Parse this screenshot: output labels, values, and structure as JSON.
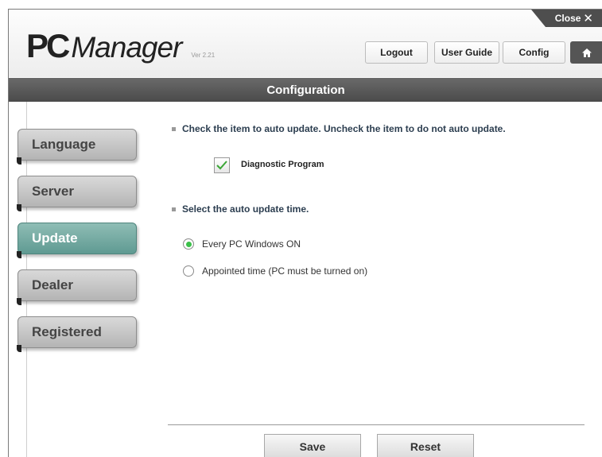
{
  "window": {
    "close_label": "Close"
  },
  "header": {
    "logo_pc": "PC",
    "logo_manager": "Manager",
    "version": "Ver 2.21",
    "buttons": {
      "logout": "Logout",
      "user_guide": "User Guide",
      "config": "Config"
    },
    "home_icon": "home-icon"
  },
  "title": "Configuration",
  "sidebar": {
    "items": [
      {
        "label": "Language",
        "active": false
      },
      {
        "label": "Server",
        "active": false
      },
      {
        "label": "Update",
        "active": true
      },
      {
        "label": "Dealer",
        "active": false
      },
      {
        "label": "Registered",
        "active": false
      }
    ]
  },
  "main": {
    "auto_update_instruction": "Check the item to auto update. Uncheck the item to do not auto update.",
    "checkbox": {
      "label": "Diagnostic Program",
      "checked": true
    },
    "time_instruction": "Select the auto update time.",
    "radios": [
      {
        "label": "Every PC Windows ON",
        "selected": true
      },
      {
        "label": "Appointed time (PC must be turned on)",
        "selected": false
      }
    ],
    "save_label": "Save",
    "reset_label": "Reset"
  },
  "colors": {
    "accent": "#6ea69e",
    "radio_selected": "#3cc04a",
    "check": "#3aa635",
    "titlebar": "#555555"
  }
}
